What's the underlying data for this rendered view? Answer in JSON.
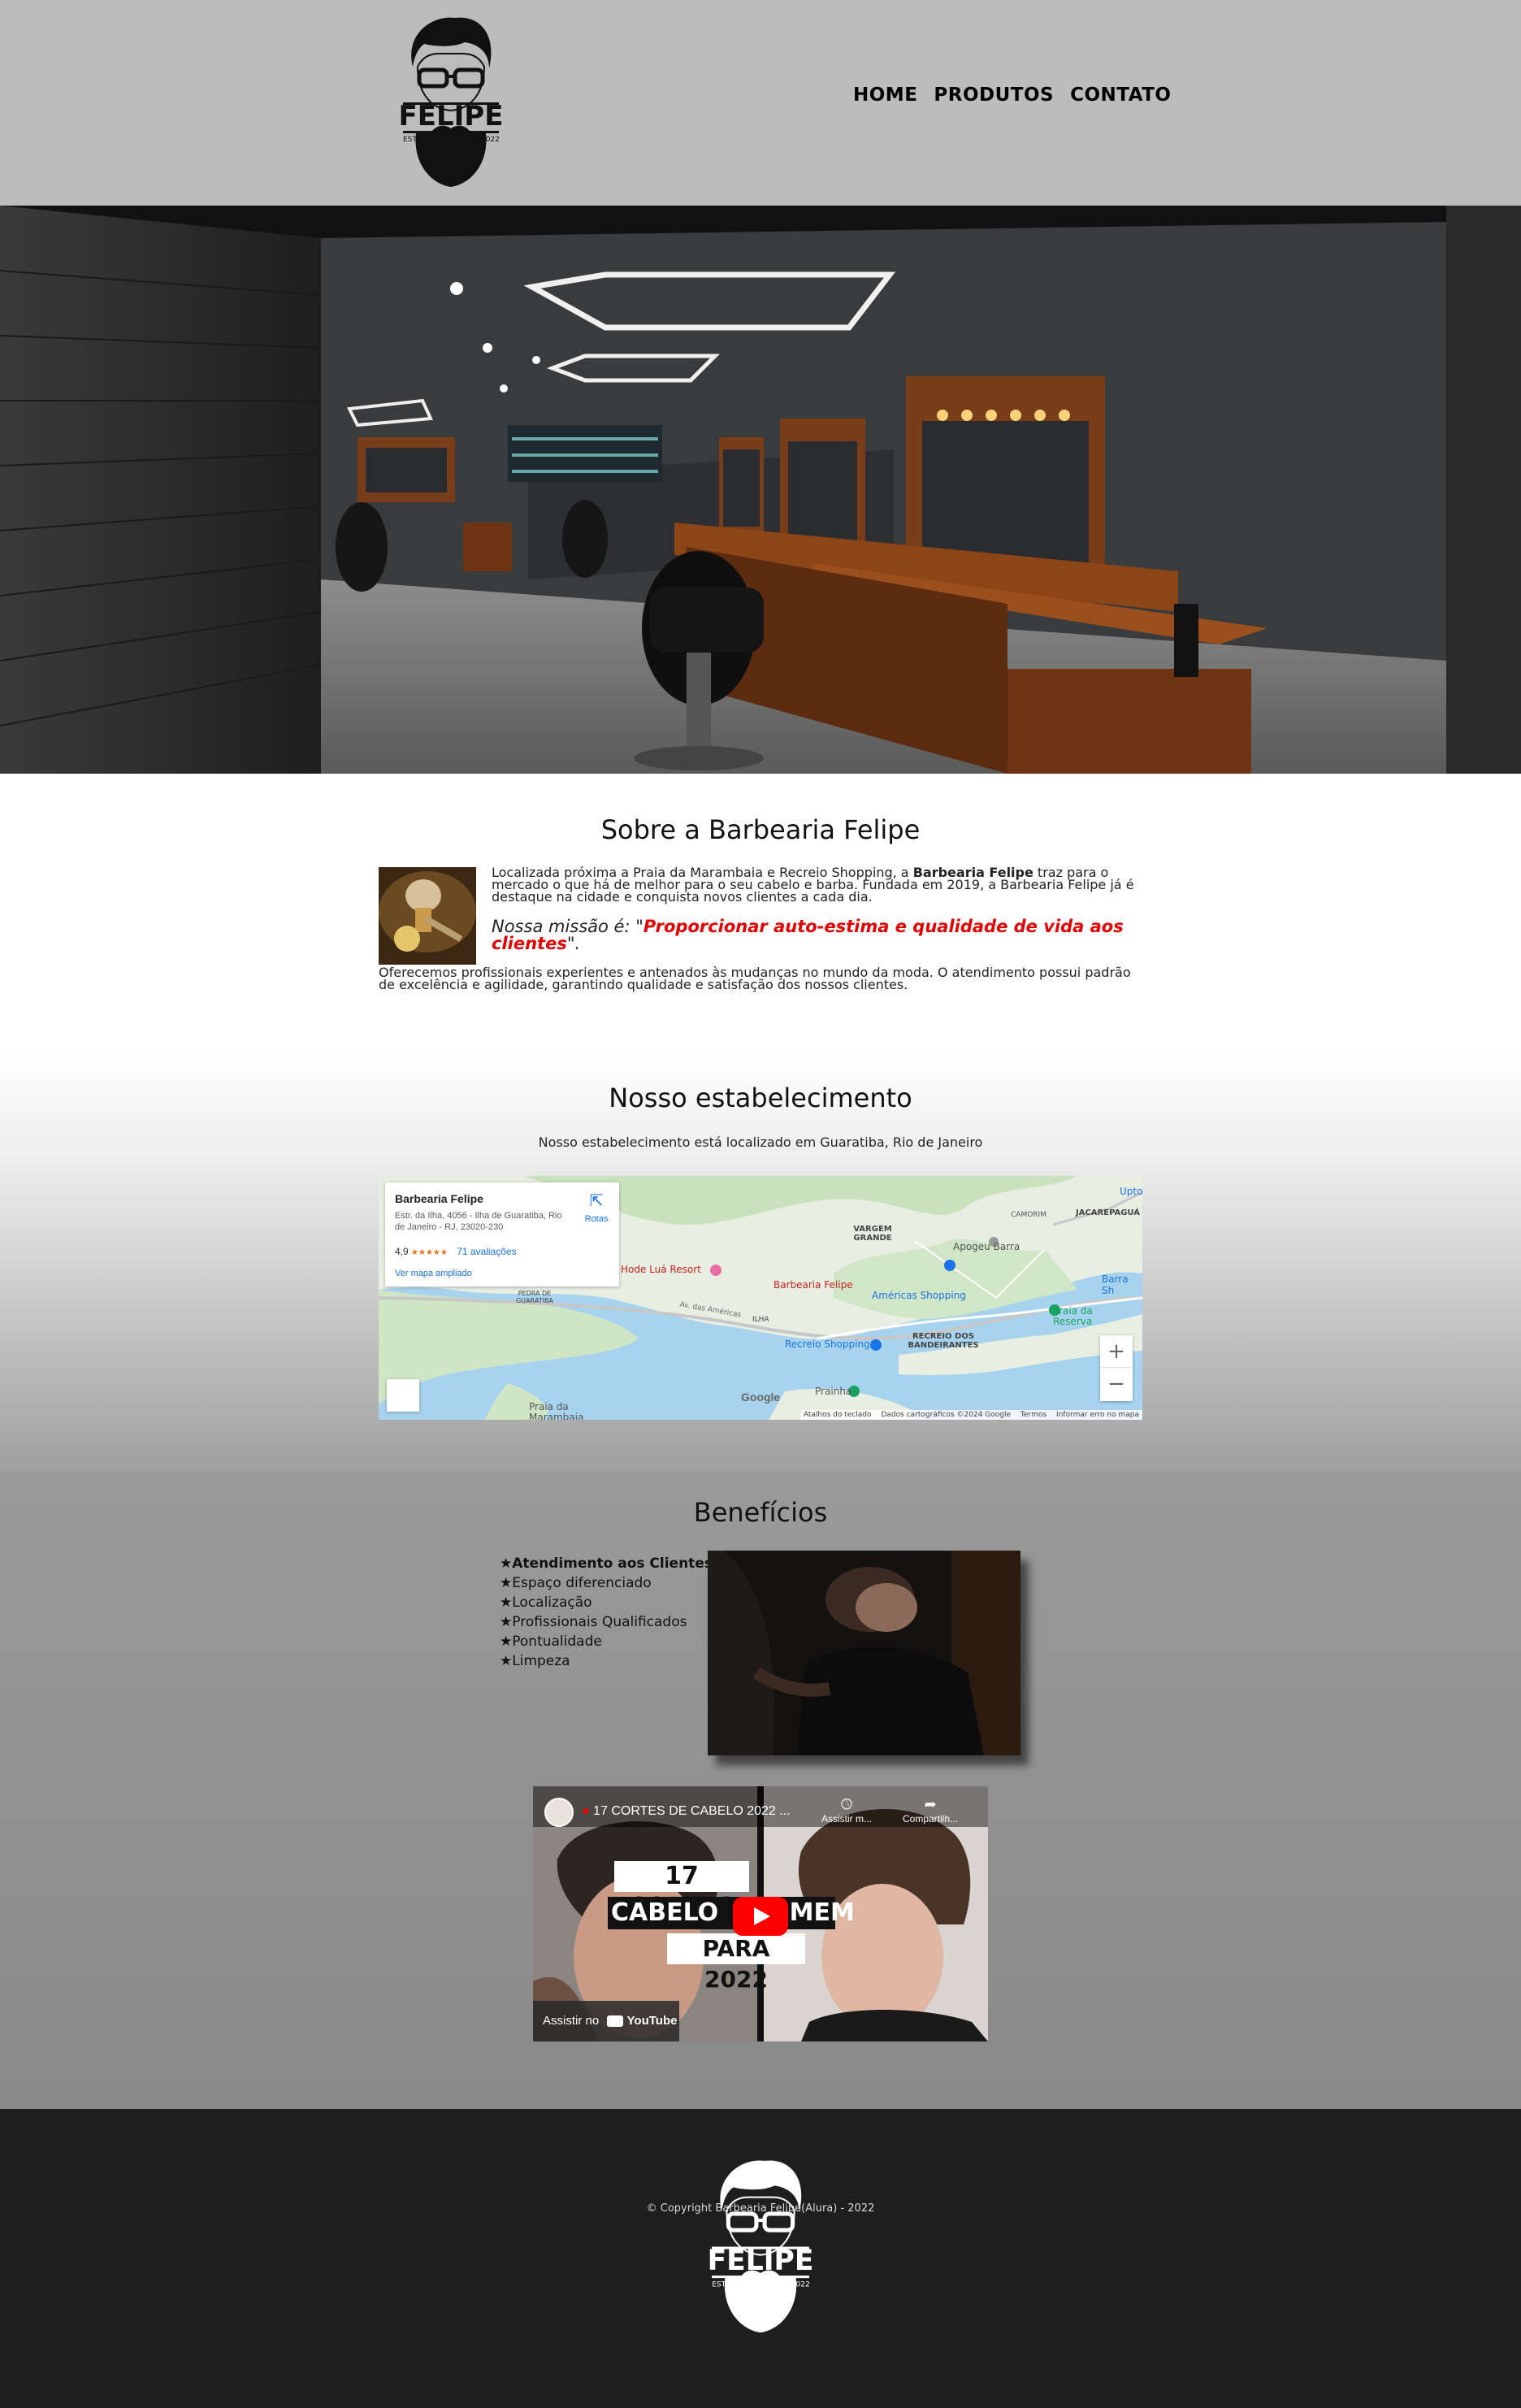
{
  "header": {
    "logo": {
      "name": "FELIPE",
      "est": "ESTD",
      "year": "2022"
    },
    "nav": {
      "home": "HOME",
      "produtos": "PRODUTOS",
      "contato": "CONTATO"
    }
  },
  "sobre": {
    "title": "Sobre a Barbearia Felipe",
    "p1_before": "Localizada próxima a Praia da Marambaia e Recreio Shopping, a ",
    "p1_bold": "Barbearia Felipe",
    "p1_after": " traz para o mercado o que há de melhor para o seu cabelo e barba. Fundada em 2019, a Barbearia Felipe já é destaque na cidade e conquista novos clientes a cada dia.",
    "mission_label": "Nossa missão é: \"",
    "mission_text": "Proporcionar auto-estima e qualidade de vida aos clientes",
    "mission_end": "\".",
    "p2": "Oferecemos profissionais experientes e antenados às mudanças no mundo da moda. O atendimento possui padrão de excelência e agilidade, garantindo qualidade e satisfação dos nossos clientes."
  },
  "estabelecimento": {
    "title": "Nosso estabelecimento",
    "subtitle": "Nosso estabelecimento está localizado em Guaratiba, Rio de Janeiro",
    "map": {
      "card_title": "Barbearia Felipe",
      "card_address": "Estr. da Ilha, 4056 - Ilha de Guaratiba, Rio de Janeiro - RJ, 23020-230",
      "rating": "4,9",
      "stars": "★★★★★",
      "reviews": "71 avaliações",
      "larger_map": "Ver mapa ampliado",
      "directions": "Rotas",
      "places": [
        "Barbearia Felipe",
        "Hode Luá Resort",
        "VARGEM GRANDE",
        "Apogeu Barra",
        "CAMORIM",
        "JACAREPAGUÁ",
        "Barra Sh",
        "Américas Shopping",
        "Recreio Shopping",
        "RECREIO DOS BANDEIRANTES",
        "Praia da Reserva",
        "Prainha",
        "PEDRA DE GUARATIBA",
        "Praia da Marambaia",
        "ILHA",
        "Upto",
        "Av. das Américas"
      ],
      "zoom_in": "+",
      "zoom_out": "−",
      "footer": [
        "Atalhos do teclado",
        "Dados cartográficos ©2024 Google",
        "Termos",
        "Informar erro no mapa"
      ],
      "google": "Google",
      "colors": {
        "water": "#a8d3ee",
        "land": "#e6f0df",
        "green": "#cfe6c4",
        "road": "#ffffff",
        "pin": "#e84235"
      }
    }
  },
  "beneficios": {
    "title": "Benefícios",
    "items": [
      "Atendimento aos Clientes",
      "Espaço diferenciado",
      "Localização",
      "Profissionais Qualificados",
      "Pontualidade",
      "Limpeza"
    ],
    "video": {
      "title": "17 CORTES DE CABELO 2022 ...",
      "watch_later": "Assistir m...",
      "share": "Compartilh...",
      "thumb_line1": "17 CORTES",
      "thumb_line2a": "CABELO",
      "thumb_line2b": "HOMEM",
      "thumb_line3": "PARA 2022",
      "watch_on": "Assistir no",
      "youtube": "YouTube"
    }
  },
  "footer": {
    "copyright": "© Copyright Barbearia Felipe(Alura) - 2022"
  }
}
